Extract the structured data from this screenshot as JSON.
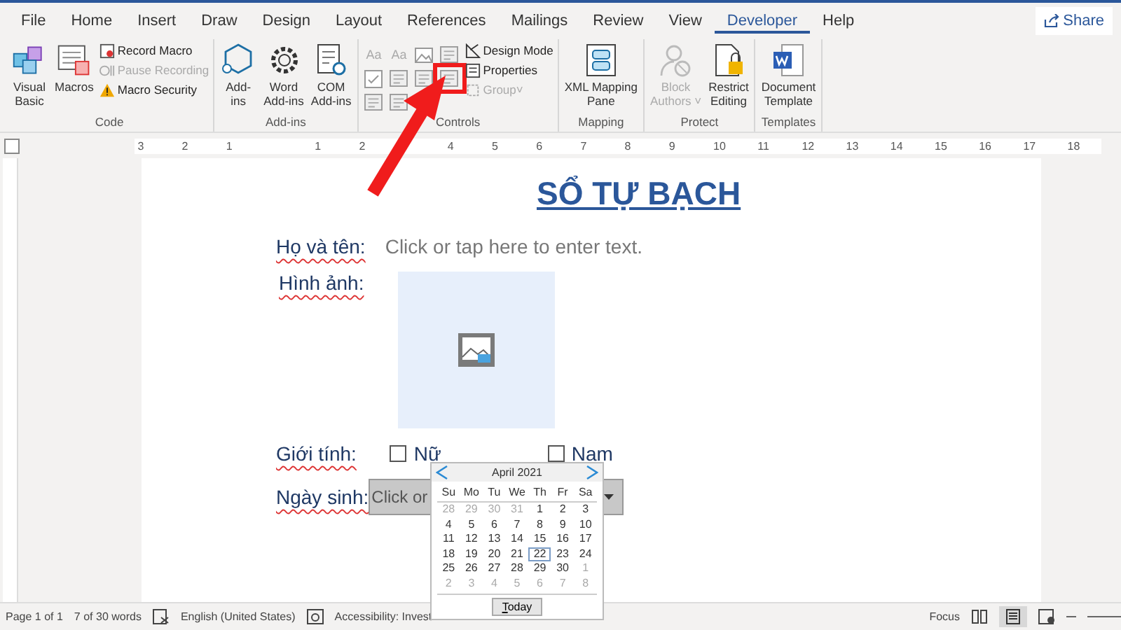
{
  "tabs": [
    {
      "label": "File",
      "selected": false
    },
    {
      "label": "Home",
      "selected": false
    },
    {
      "label": "Insert",
      "selected": false
    },
    {
      "label": "Draw",
      "selected": false
    },
    {
      "label": "Design",
      "selected": false
    },
    {
      "label": "Layout",
      "selected": false
    },
    {
      "label": "References",
      "selected": false
    },
    {
      "label": "Mailings",
      "selected": false
    },
    {
      "label": "Review",
      "selected": false
    },
    {
      "label": "View",
      "selected": false
    },
    {
      "label": "Developer",
      "selected": true
    },
    {
      "label": "Help",
      "selected": false
    }
  ],
  "share_button": "Share",
  "ribbon": {
    "code": {
      "name": "Code",
      "large": [
        {
          "lines": [
            "Visual",
            "Basic"
          ]
        },
        {
          "lines": [
            "Macros"
          ]
        }
      ],
      "small": [
        {
          "label": "Record Macro",
          "disabled": false
        },
        {
          "label": "Pause Recording",
          "disabled": true
        },
        {
          "label": "Macro Security",
          "disabled": false
        }
      ]
    },
    "addins": {
      "name": "Add-ins",
      "large": [
        {
          "lines": [
            "Add-",
            "ins"
          ]
        },
        {
          "lines": [
            "Word",
            "Add-ins"
          ]
        },
        {
          "lines": [
            "COM",
            "Add-ins"
          ]
        }
      ]
    },
    "controls": {
      "name": "Controls",
      "grid": [
        {
          "kind": "text",
          "label": "Aa",
          "highlighted": false
        },
        {
          "kind": "text",
          "label": "Aa",
          "highlighted": false
        },
        {
          "kind": "image",
          "highlighted": false
        },
        {
          "kind": "stack",
          "highlighted": false
        },
        {
          "kind": "check",
          "highlighted": false
        },
        {
          "kind": "combo",
          "highlighted": false
        },
        {
          "kind": "list",
          "highlighted": false
        },
        {
          "kind": "date",
          "highlighted": true
        },
        {
          "kind": "legacy",
          "highlighted": false
        },
        {
          "kind": "tools",
          "highlighted": false
        }
      ],
      "small": [
        {
          "label": "Design Mode",
          "disabled": false
        },
        {
          "label": "Properties",
          "disabled": false
        },
        {
          "label": "Group",
          "caret": "˅",
          "disabled": true
        }
      ]
    },
    "mapping": {
      "name": "Mapping",
      "large": [
        {
          "lines": [
            "XML Mapping",
            "Pane"
          ],
          "disabled": false
        }
      ]
    },
    "protect": {
      "name": "Protect",
      "large": [
        {
          "lines": [
            "Block",
            "Authors ˅"
          ],
          "disabled": true
        },
        {
          "lines": [
            "Restrict",
            "Editing"
          ],
          "disabled": false
        }
      ]
    },
    "templates": {
      "name": "Templates",
      "large": [
        {
          "lines": [
            "Document",
            "Template"
          ],
          "disabled": false
        }
      ]
    }
  },
  "ruler": [
    "3",
    "2",
    "1",
    "1",
    "2",
    "4",
    "5",
    "6",
    "7",
    "8",
    "9",
    "10",
    "11",
    "12",
    "13",
    "14",
    "15",
    "16",
    "17",
    "18"
  ],
  "document": {
    "title": "SỔ TỰ BẠCH",
    "name_label": "Họ và tên:",
    "name_placeholder": "Click or tap here to enter text.",
    "photo_label": "Hình ảnh:",
    "gender_label": "Giới tính:",
    "genders": [
      {
        "label": "Nữ",
        "checked": false
      },
      {
        "label": "Nam",
        "checked": false
      }
    ],
    "birth_label": "Ngày sinh:",
    "birth_placeholder": "Click or"
  },
  "calendar": {
    "month": "April 2021",
    "weekdays": [
      "Su",
      "Mo",
      "Tu",
      "We",
      "Th",
      "Fr",
      "Sa"
    ],
    "days": [
      {
        "d": "28",
        "muted": true,
        "selected": false
      },
      {
        "d": "29",
        "muted": true,
        "selected": false
      },
      {
        "d": "30",
        "muted": true,
        "selected": false
      },
      {
        "d": "31",
        "muted": true,
        "selected": false
      },
      {
        "d": "1",
        "muted": false,
        "selected": false
      },
      {
        "d": "2",
        "muted": false,
        "selected": false
      },
      {
        "d": "3",
        "muted": false,
        "selected": false
      },
      {
        "d": "4",
        "muted": false,
        "selected": false
      },
      {
        "d": "5",
        "muted": false,
        "selected": false
      },
      {
        "d": "6",
        "muted": false,
        "selected": false
      },
      {
        "d": "7",
        "muted": false,
        "selected": false
      },
      {
        "d": "8",
        "muted": false,
        "selected": false
      },
      {
        "d": "9",
        "muted": false,
        "selected": false
      },
      {
        "d": "10",
        "muted": false,
        "selected": false
      },
      {
        "d": "11",
        "muted": false,
        "selected": false
      },
      {
        "d": "12",
        "muted": false,
        "selected": false
      },
      {
        "d": "13",
        "muted": false,
        "selected": false
      },
      {
        "d": "14",
        "muted": false,
        "selected": false
      },
      {
        "d": "15",
        "muted": false,
        "selected": false
      },
      {
        "d": "16",
        "muted": false,
        "selected": false
      },
      {
        "d": "17",
        "muted": false,
        "selected": false
      },
      {
        "d": "18",
        "muted": false,
        "selected": false
      },
      {
        "d": "19",
        "muted": false,
        "selected": false
      },
      {
        "d": "20",
        "muted": false,
        "selected": false
      },
      {
        "d": "21",
        "muted": false,
        "selected": false
      },
      {
        "d": "22",
        "muted": false,
        "selected": true
      },
      {
        "d": "23",
        "muted": false,
        "selected": false
      },
      {
        "d": "24",
        "muted": false,
        "selected": false
      },
      {
        "d": "25",
        "muted": false,
        "selected": false
      },
      {
        "d": "26",
        "muted": false,
        "selected": false
      },
      {
        "d": "27",
        "muted": false,
        "selected": false
      },
      {
        "d": "28",
        "muted": false,
        "selected": false
      },
      {
        "d": "29",
        "muted": false,
        "selected": false
      },
      {
        "d": "30",
        "muted": false,
        "selected": false
      },
      {
        "d": "1",
        "muted": true,
        "selected": false
      },
      {
        "d": "2",
        "muted": true,
        "selected": false
      },
      {
        "d": "3",
        "muted": true,
        "selected": false
      },
      {
        "d": "4",
        "muted": true,
        "selected": false
      },
      {
        "d": "5",
        "muted": true,
        "selected": false
      },
      {
        "d": "6",
        "muted": true,
        "selected": false
      },
      {
        "d": "7",
        "muted": true,
        "selected": false
      },
      {
        "d": "8",
        "muted": true,
        "selected": false
      }
    ],
    "today_button": "Today"
  },
  "status_bar": {
    "page": "Page 1 of 1",
    "words": "7 of 30 words",
    "language": "English (United States)",
    "accessibility": "Accessibility: Invest",
    "focus": "Focus"
  }
}
